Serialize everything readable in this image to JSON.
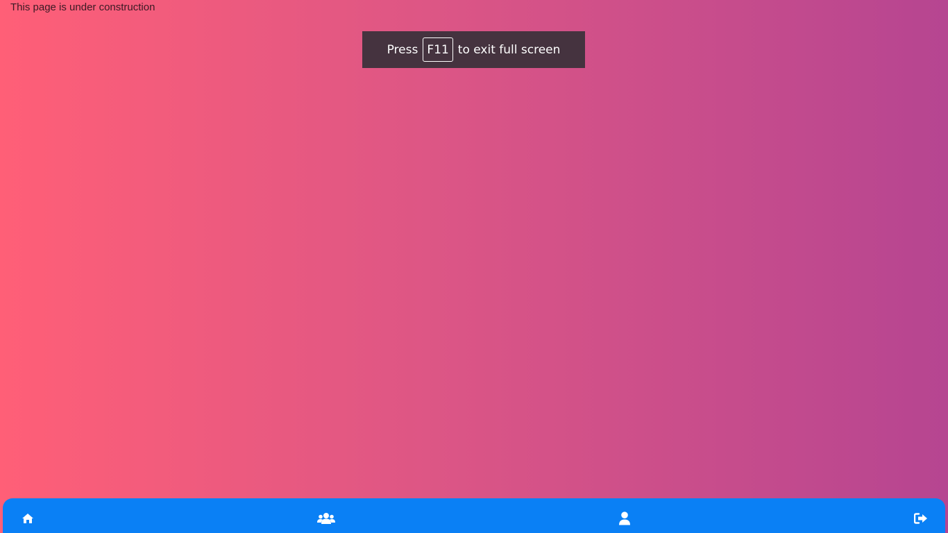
{
  "page": {
    "notice_text": "This page is under construction"
  },
  "fullscreen_toast": {
    "press_label": "Press",
    "key_label": "F11",
    "suffix_label": "to exit full screen"
  },
  "bottom_nav": {
    "items": [
      {
        "icon": "home-icon"
      },
      {
        "icon": "users-icon"
      },
      {
        "icon": "user-icon"
      },
      {
        "icon": "sign-out-icon"
      }
    ]
  },
  "colors": {
    "gradient_start": "#ff5f77",
    "gradient_end": "#b64591",
    "nav_background": "#0a80f5",
    "toast_background": "#45333f"
  }
}
